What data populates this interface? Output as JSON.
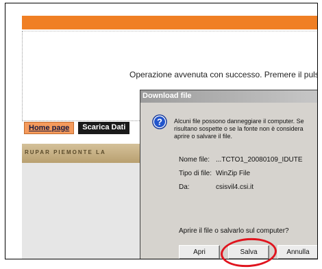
{
  "page": {
    "message": "Operazione avvenuta con successo. Premere il pulsa",
    "nav": {
      "home_label": "Home page",
      "scarica_label": "Scarica Dati"
    },
    "banner_text": "RUPAR PIEMONTE LA"
  },
  "dialog": {
    "title": "Download file",
    "icon": "question-icon",
    "warning_lines": [
      "Alcuni file possono danneggiare il computer. Se",
      "risultano sospette o se la fonte non è considera",
      "aprire o salvare il file."
    ],
    "file_name_label": "Nome file:",
    "file_name_value": "...TCTO1_20080109_IDUTE",
    "file_type_label": "Tipo di file:",
    "file_type_value": "WinZip File",
    "from_label": "Da:",
    "from_value": "csisvil4.csi.it",
    "prompt": "Aprire il file o salvarlo sul computer?",
    "buttons": {
      "open": "Apri",
      "save": "Salva",
      "cancel": "Annulla"
    }
  },
  "colors": {
    "orange_bar": "#f07f24",
    "highlight_circle": "#e0141e"
  }
}
